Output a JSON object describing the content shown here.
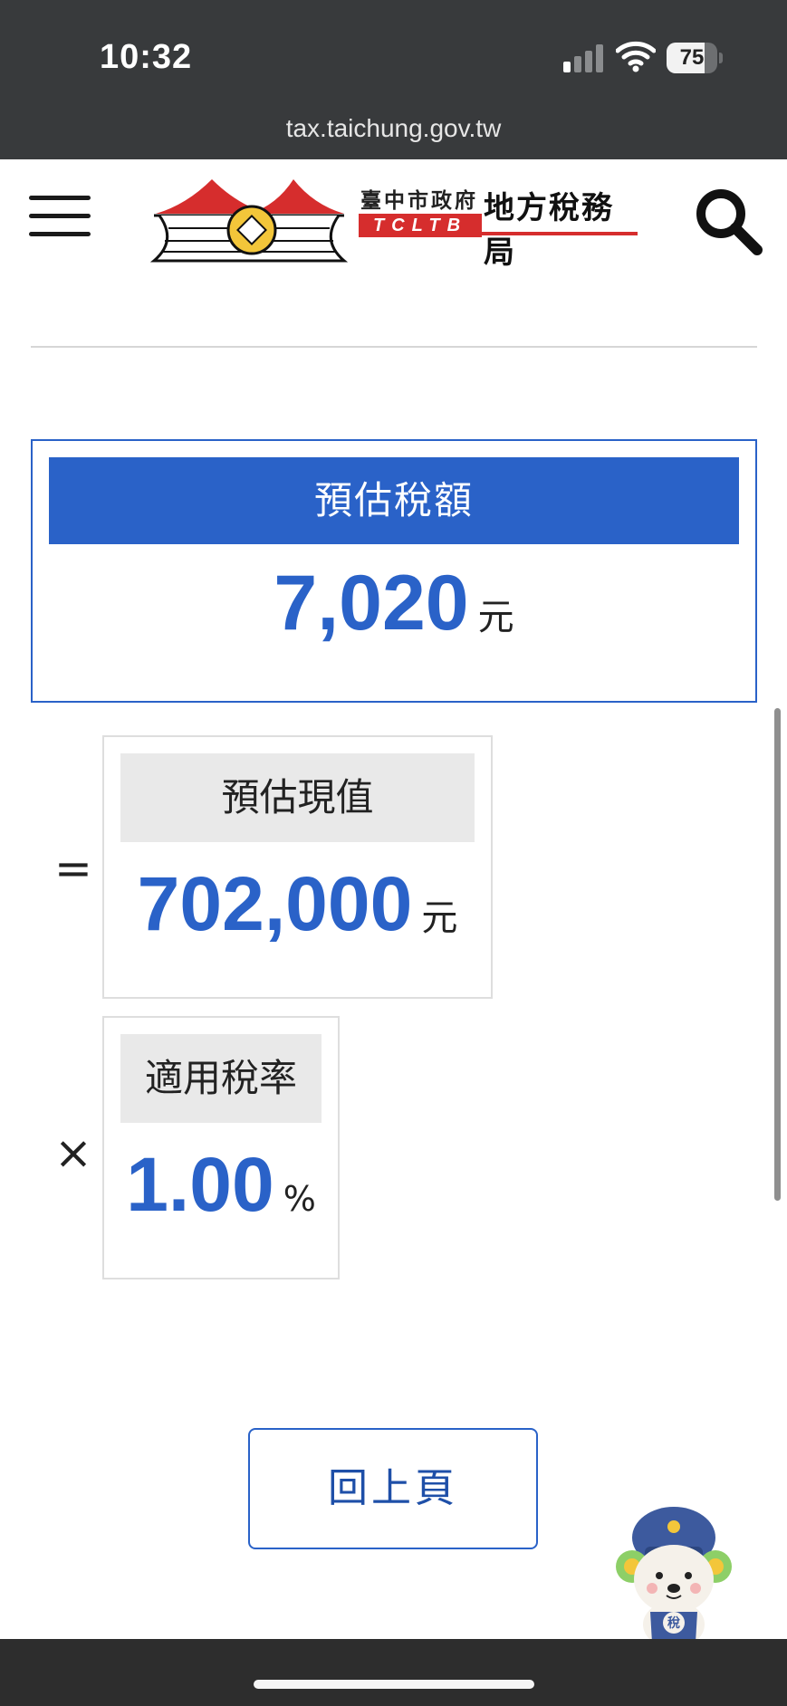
{
  "status_bar": {
    "time": "10:32",
    "battery_percent": "75"
  },
  "browser": {
    "url": "tax.taichung.gov.tw"
  },
  "site": {
    "logo_name": "臺中市政府",
    "logo_abbr": "TCLTB",
    "logo_office": "地方稅務局",
    "brand_red": "#d62d2d",
    "brand_yellow": "#f3c63a"
  },
  "result": {
    "title": "預估稅額",
    "value": "7,020",
    "unit": "元"
  },
  "operands": [
    {
      "sign": "=",
      "label": "預估現值",
      "value": "702,000",
      "unit": "元"
    },
    {
      "sign": "×",
      "label": "適用稅率",
      "value": "1.00",
      "unit": "%"
    }
  ],
  "back_button": {
    "label": "回上頁"
  },
  "mascot": {
    "badge": "稅"
  },
  "colors": {
    "accent": "#2a62c8",
    "header_bg": "#383a3c",
    "box_header_bg": "#e9e9e9"
  }
}
